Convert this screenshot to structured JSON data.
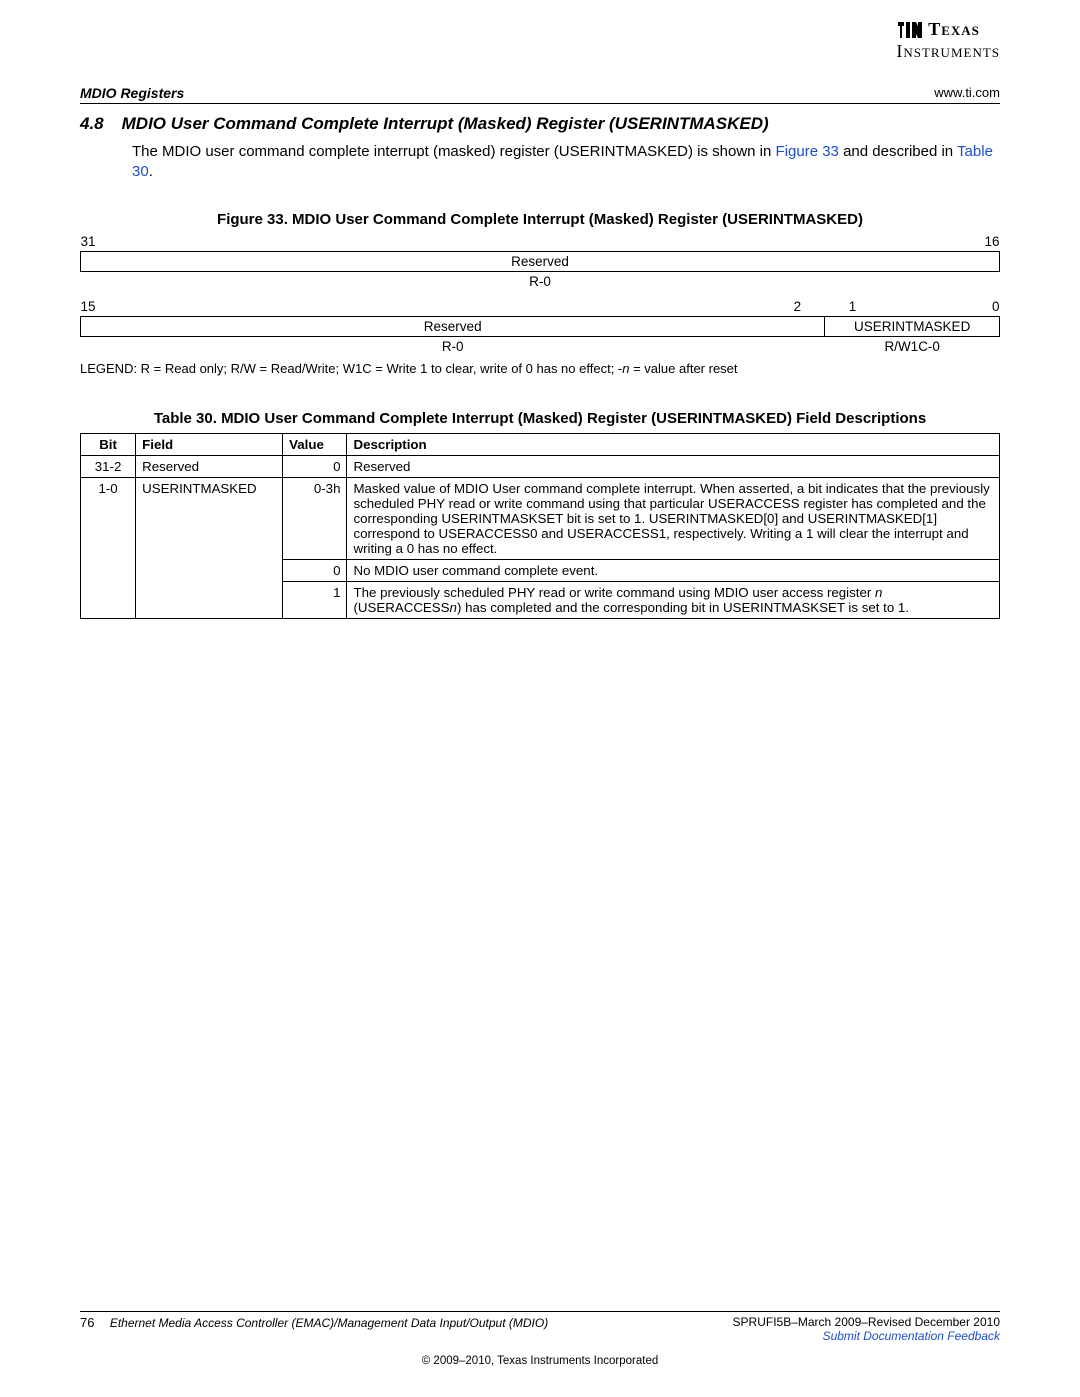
{
  "logo": {
    "line1": "Texas",
    "line2": "Instruments"
  },
  "header": {
    "left": "MDIO Registers",
    "right": "www.ti.com"
  },
  "section": {
    "num": "4.8",
    "title": "MDIO User Command Complete Interrupt (Masked) Register (USERINTMASKED)"
  },
  "intro": {
    "pre": "The MDIO user command complete interrupt (masked) register (USERINTMASKED) is shown in ",
    "figlink": "Figure 33",
    "mid": " and described in ",
    "tbllink": "Table 30",
    "post": "."
  },
  "figure": {
    "caption": "Figure 33. MDIO User Command Complete Interrupt (Masked) Register (USERINTMASKED)"
  },
  "register": {
    "row1": {
      "hi": "31",
      "lo": "16",
      "name": "Reserved",
      "rw": "R-0"
    },
    "row2": {
      "b15": "15",
      "b2": "2",
      "b1": "1",
      "b0": "0",
      "nameL": "Reserved",
      "rwL": "R-0",
      "nameR": "USERINTMASKED",
      "rwR": "R/W1C-0"
    }
  },
  "legend": {
    "pre": "LEGEND: R = Read only; R/W = Read/Write; W1C = Write 1 to clear, write of 0 has no effect; -",
    "n": "n",
    "post": " = value after reset"
  },
  "table": {
    "caption": "Table 30. MDIO User Command Complete Interrupt (Masked) Register (USERINTMASKED) Field Descriptions",
    "head": {
      "bit": "Bit",
      "field": "Field",
      "value": "Value",
      "desc": "Description"
    },
    "rows": {
      "r0": {
        "bit": "31-2",
        "field": "Reserved",
        "value": "0",
        "desc": "Reserved"
      },
      "r1": {
        "bit": "1-0",
        "field": "USERINTMASKED",
        "value": "0-3h",
        "desc": "Masked value of MDIO User command complete interrupt. When asserted, a bit indicates that the previously scheduled PHY read or write command using that particular USERACCESS register has completed and the corresponding USERINTMASKSET bit is set to 1. USERINTMASKED[0] and USERINTMASKED[1] correspond to USERACCESS0 and USERACCESS1, respectively. Writing a 1 will clear the interrupt and writing a 0 has no effect."
      },
      "r2": {
        "value": "0",
        "desc": "No MDIO user command complete event."
      },
      "r3": {
        "value": "1",
        "descPre": "The previously scheduled PHY read or write command using MDIO user access register ",
        "descN": "n",
        "descMid": " (USERACCESS",
        "descN2": "n",
        "descPost": ") has completed and the corresponding bit in USERINTMASKSET is set to 1."
      }
    }
  },
  "footer": {
    "page": "76",
    "title": "Ethernet Media Access Controller (EMAC)/Management Data Input/Output (MDIO)",
    "docid": "SPRUFI5B–March 2009–Revised December 2010",
    "feedback": "Submit Documentation Feedback",
    "copyright": "© 2009–2010, Texas Instruments Incorporated"
  }
}
